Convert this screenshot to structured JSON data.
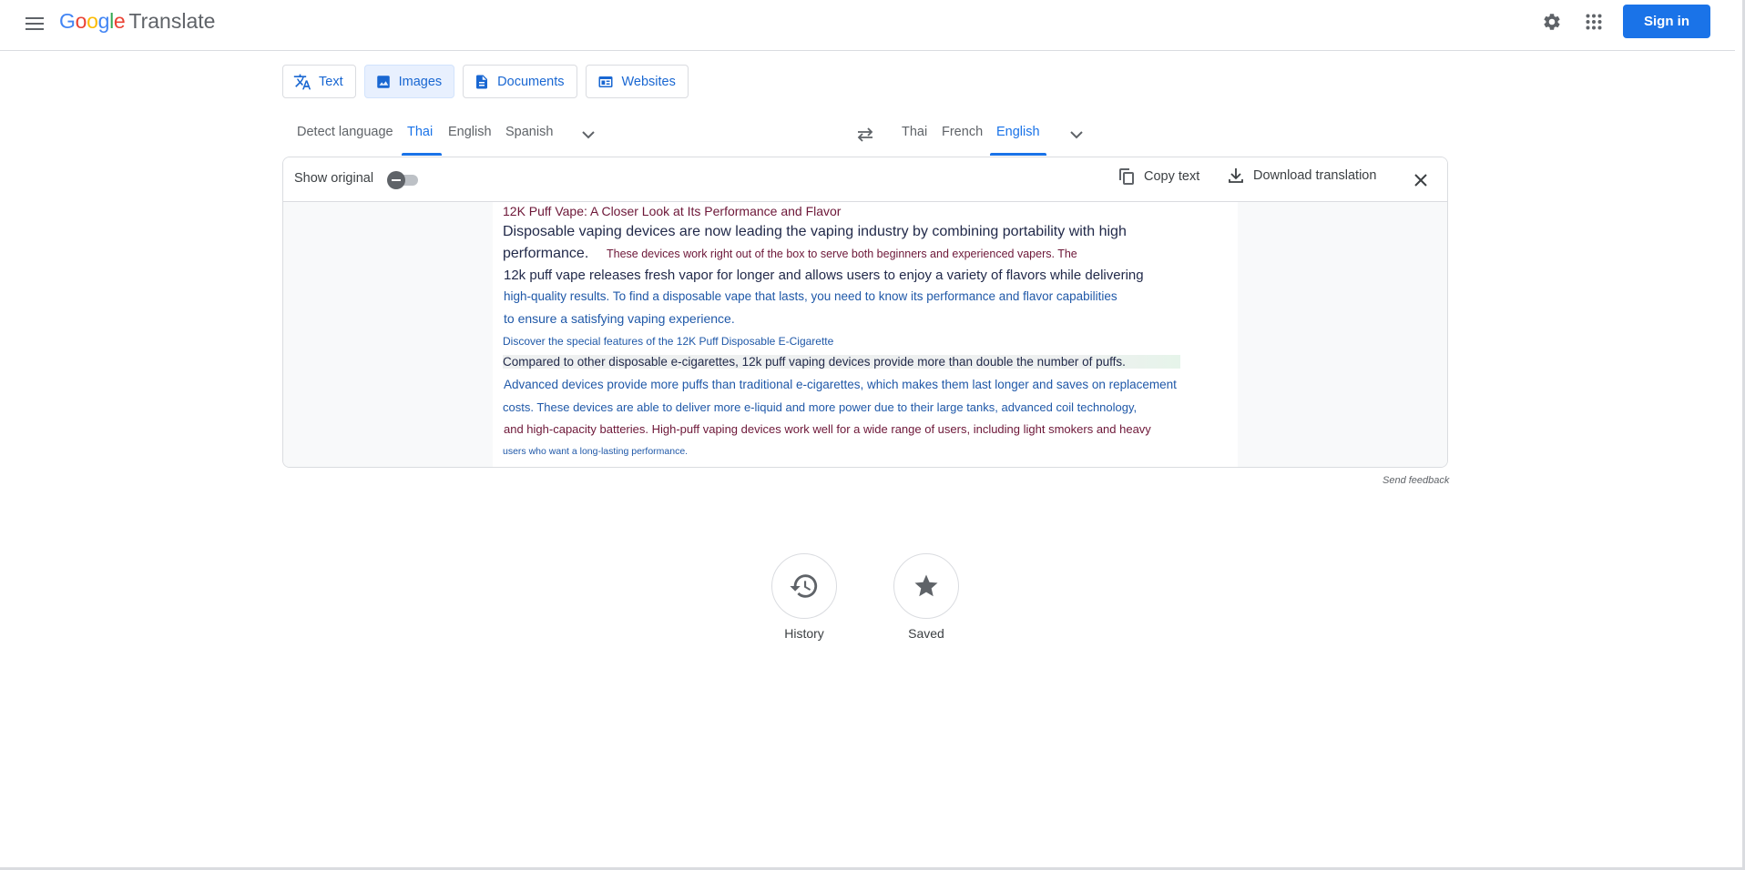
{
  "header": {
    "menu_icon": "hamburger-menu-icon",
    "logo_google": [
      "G",
      "o",
      "o",
      "g",
      "l",
      "e"
    ],
    "logo_colors": [
      "#4285f4",
      "#ea4335",
      "#fbbc05",
      "#4285f4",
      "#34a853",
      "#ea4335"
    ],
    "product": "Translate",
    "settings_icon": "gear-icon",
    "apps_icon": "apps-grid-icon",
    "sign_in": "Sign in"
  },
  "modes": [
    {
      "label": "Text",
      "icon": "translate-icon",
      "active": false
    },
    {
      "label": "Images",
      "icon": "image-icon",
      "active": true
    },
    {
      "label": "Documents",
      "icon": "document-icon",
      "active": false
    },
    {
      "label": "Websites",
      "icon": "website-icon",
      "active": false
    }
  ],
  "source_langs": {
    "items": [
      "Detect language",
      "Thai",
      "English",
      "Spanish"
    ],
    "active": "Thai"
  },
  "target_langs": {
    "items": [
      "Thai",
      "French",
      "English"
    ],
    "active": "English"
  },
  "panel": {
    "show_original": "Show original",
    "show_original_on": false,
    "copy_text": "Copy text",
    "download": "Download translation"
  },
  "translated_lines": [
    "12K Puff Vape: A Closer Look at Its Performance and Flavor",
    "Disposable vaping devices are now leading the vaping industry by combining portability with high",
    "performance.",
    "These devices work right out of the box to serve both beginners and experienced vapers. The",
    "12k puff vape releases fresh vapor for longer and allows users to enjoy a variety of flavors while delivering",
    "high-quality results. To find a disposable vape that lasts, you need to know its performance and flavor capabilities",
    "to ensure a satisfying vaping experience.",
    "Discover the special features of the 12K Puff Disposable E-Cigarette",
    "Compared to other disposable e-cigarettes, 12k puff vaping devices provide more than double the number of puffs.",
    "Advanced devices provide more puffs than traditional e-cigarettes, which makes them last longer and saves on replacement",
    "costs. These devices are able to deliver more e-liquid and more power due to their large tanks, advanced coil technology,",
    "and high-capacity batteries. High-puff vaping devices work well for a wide range of users, including light smokers and heavy",
    "users who want a long-lasting performance."
  ],
  "send_feedback": "Send feedback",
  "bottom": {
    "history": "History",
    "saved": "Saved"
  }
}
